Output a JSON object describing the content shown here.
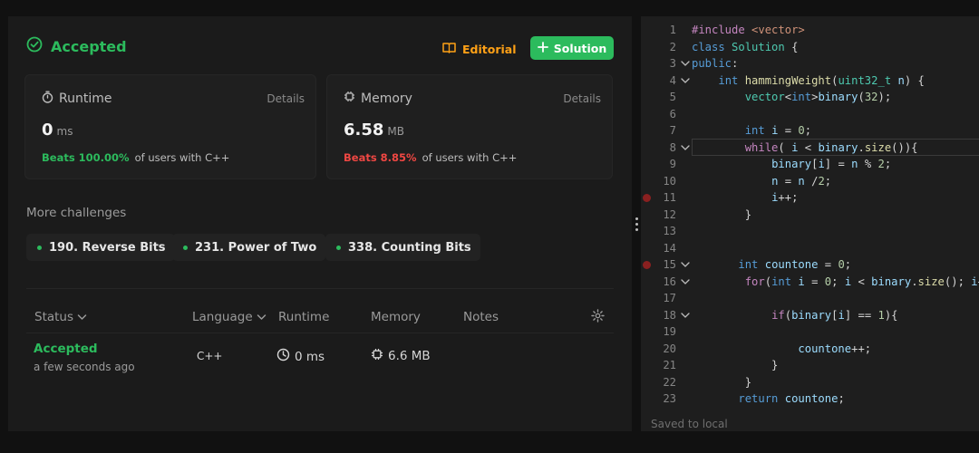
{
  "result": {
    "status": "Accepted",
    "editorial_label": "Editorial",
    "solution_label": "Solution"
  },
  "runtime_card": {
    "title": "Runtime",
    "details_label": "Details",
    "value": "0",
    "unit": "ms",
    "beats": "Beats 100.00%",
    "beats_suffix": "of users with C++"
  },
  "memory_card": {
    "title": "Memory",
    "details_label": "Details",
    "value": "6.58",
    "unit": "MB",
    "beats": "Beats 8.85%",
    "beats_suffix": "of users with C++"
  },
  "more_challenges": {
    "title": "More challenges",
    "items": [
      "190. Reverse Bits",
      "231. Power of Two",
      "338. Counting Bits"
    ]
  },
  "table": {
    "headers": {
      "status": "Status",
      "language": "Language",
      "runtime": "Runtime",
      "memory": "Memory",
      "notes": "Notes"
    },
    "rows": [
      {
        "status": "Accepted",
        "time": "a few seconds ago",
        "language": "C++",
        "runtime": "0 ms",
        "memory": "6.6 MB"
      }
    ]
  },
  "editor": {
    "saved_text": "Saved to local",
    "lines": [
      "#include <vector>",
      "class Solution {",
      "public:",
      "    int hammingWeight(uint32_t n) {",
      "        vector<int>binary(32);",
      "",
      "        int i = 0;",
      "        while( i < binary.size()){",
      "            binary[i] = n % 2;",
      "            n = n /2;",
      "            i++;",
      "        }",
      "",
      "",
      "       int countone = 0;",
      "        for(int i = 0; i < binary.size(); i++",
      "",
      "            if(binary[i] == 1){",
      "",
      "                countone++;",
      "            }",
      "        }",
      "       return countone;"
    ]
  },
  "colors": {
    "accent_green": "#2cbb5d",
    "accent_orange": "#ffa116",
    "accent_red": "#ef4743"
  }
}
